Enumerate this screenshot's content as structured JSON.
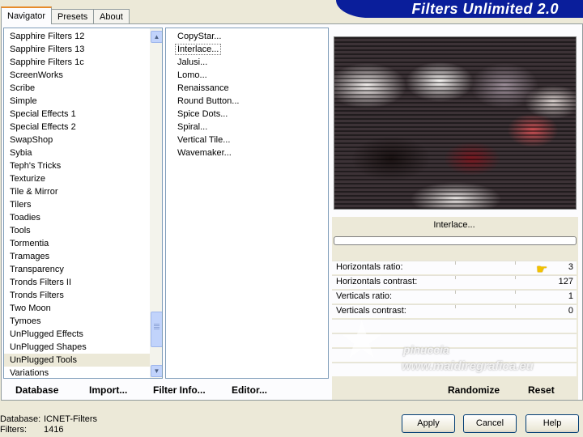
{
  "tabs": [
    "Navigator",
    "Presets",
    "About"
  ],
  "banner_title": "Filters Unlimited 2.0",
  "categories": [
    "Sapphire Filters 12",
    "Sapphire Filters 13",
    "Sapphire Filters 1c",
    "ScreenWorks",
    "Scribe",
    "Simple",
    "Special Effects 1",
    "Special Effects 2",
    "SwapShop",
    "Sybia",
    "Teph's Tricks",
    "Texturize",
    "Tile & Mirror",
    "Tilers",
    "Toadies",
    "Tools",
    "Tormentia",
    "Tramages",
    "Transparency",
    "Tronds Filters II",
    "Tronds Filters",
    "Two Moon",
    "Tymoes",
    "UnPlugged Effects",
    "UnPlugged Shapes",
    "UnPlugged Tools",
    "Variations"
  ],
  "selected_category": "UnPlugged Tools",
  "filters": [
    "CopyStar...",
    "Interlace...",
    "Jalusi...",
    "Lomo...",
    "Renaissance",
    "Round Button...",
    "Spice Dots...",
    "Spiral...",
    "Vertical Tile...",
    "Wavemaker..."
  ],
  "selected_filter": "Interlace...",
  "filter_name": "Interlace...",
  "params": [
    {
      "label": "Horizontals ratio:",
      "value": "3"
    },
    {
      "label": "Horizontals contrast:",
      "value": "127"
    },
    {
      "label": "Verticals ratio:",
      "value": "1"
    },
    {
      "label": "Verticals contrast:",
      "value": "0"
    }
  ],
  "bottom_buttons": {
    "database": "Database",
    "import": "Import...",
    "filter_info": "Filter Info...",
    "editor": "Editor...",
    "randomize": "Randomize",
    "reset": "Reset"
  },
  "watermark": {
    "name": "pinuccia",
    "url": "www.maidiregrafica.eu"
  },
  "status": {
    "database_label": "Database:",
    "database_value": "ICNET-Filters",
    "filters_label": "Filters:",
    "filters_value": "1416"
  },
  "dialog_buttons": {
    "apply": "Apply",
    "cancel": "Cancel",
    "help": "Help"
  },
  "colors": {
    "banner": "#0a1e9b",
    "face": "#ece9d8",
    "tab_accent": "#e68b2c"
  }
}
